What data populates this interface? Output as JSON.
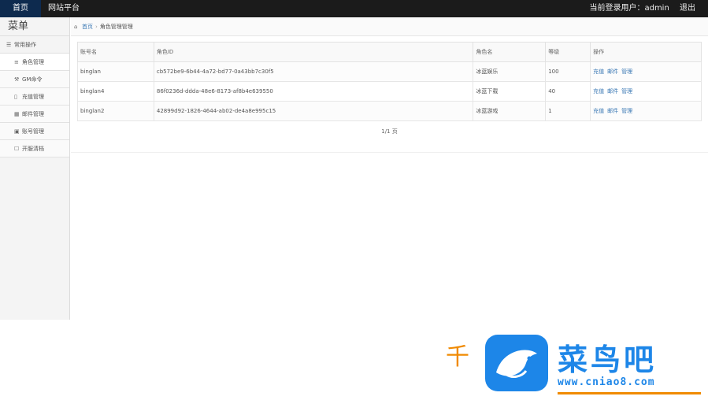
{
  "topbar": {
    "tab_home": "首页",
    "tab_site": "网站平台",
    "user_text": "当前登录用户：admin",
    "logout": "退出"
  },
  "sidebar": {
    "title": "菜单",
    "group": "常用操作",
    "items": [
      {
        "label": "角色管理",
        "icon": "list-icon"
      },
      {
        "label": "GM命令",
        "icon": "wrench-icon"
      },
      {
        "label": "充值管理",
        "icon": "file-icon"
      },
      {
        "label": "邮件管理",
        "icon": "grid-icon"
      },
      {
        "label": "账号管理",
        "icon": "image-icon"
      },
      {
        "label": "开服清档",
        "icon": "checkbox-icon"
      }
    ]
  },
  "breadcrumb": {
    "home": "首页",
    "current": "角色管理管理"
  },
  "table": {
    "headers": [
      "账号名",
      "角色ID",
      "角色名",
      "等级",
      "操作"
    ],
    "rows": [
      {
        "account": "binglan",
        "role_id": "cb572be9-6b44-4a72-bd77-0a43bb7c30f5",
        "role_name": "冰蓝娱乐",
        "level": "100",
        "actions": [
          "充值",
          "邮件",
          "管理"
        ]
      },
      {
        "account": "binglan4",
        "role_id": "86f0236d-ddda-48e6-8173-af8b4e639550",
        "role_name": "冰蓝下载",
        "level": "40",
        "actions": [
          "充值",
          "邮件",
          "管理"
        ]
      },
      {
        "account": "binglan2",
        "role_id": "42899d92-1826-4644-ab02-de4a8e995c15",
        "role_name": "冰蓝游戏",
        "level": "1",
        "actions": [
          "充值",
          "邮件",
          "管理"
        ]
      }
    ]
  },
  "pager": "1/1 页",
  "watermark": {
    "left_glyph": "千",
    "title": "菜鸟吧",
    "url": "www.cniao8.com"
  },
  "colors": {
    "topbar_bg": "#1b1b1b",
    "active_tab": "#0d2a4e",
    "link": "#3a78b4",
    "brand_blue": "#1d86e8",
    "brand_orange": "#f08a00"
  }
}
